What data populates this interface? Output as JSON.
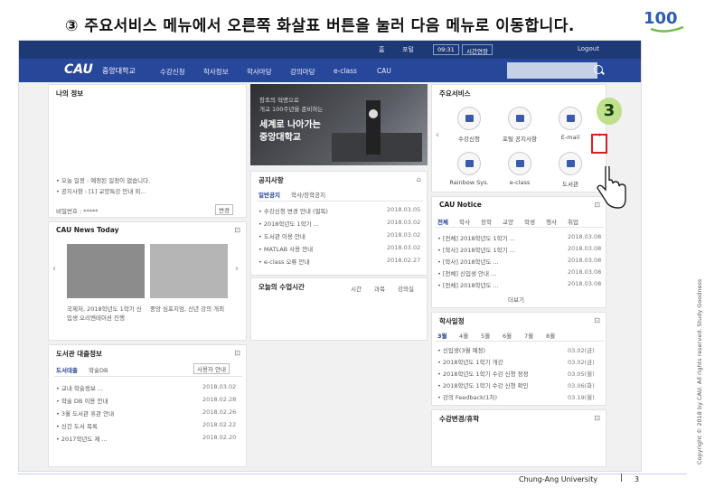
{
  "slide": {
    "title": "③ 주요서비스 메뉴에서 오른쪽 화살표 버튼을 눌러 다음 메뉴로 이동합니다.",
    "copyright": "Copyright © 2018 by CAU. All rights reserved. Study Goodness",
    "footer_university": "Chung-Ang University",
    "footer_separator": "|",
    "page_number": "3",
    "step_badge": "3",
    "logo_text": "100"
  },
  "portal": {
    "topbar": {
      "links": [
        "홈",
        "포털",
        "09:31",
        "로그아웃"
      ],
      "buttons": [
        "시간연장",
        "Logout"
      ]
    },
    "brand": "CAU",
    "brand_sub": "중앙대학교",
    "nav": [
      "수강신청",
      "학사정보",
      "학사마당",
      "강의마당",
      "e-class",
      "CAU"
    ],
    "my_menu": {
      "title": "나의 정보",
      "lines": [
        "• 오늘 일정 : 예정된 일정이 없습니다.",
        "• 공지사항 : [1] 교양특강 안내 외..."
      ],
      "password_label": "비밀번호 : *****",
      "password_btn": "변경"
    },
    "banner": {
      "line1": "창조의 혁명으로",
      "line2": "개교 100주년을 준비하는",
      "line3": "세계로 나아가는",
      "line4": "중앙대학교"
    },
    "notice": {
      "title": "공지사항",
      "tabs": [
        "일반공지",
        "학사/장학공지"
      ],
      "rows": [
        {
          "text": "• 수강신청 변경 안내 (필독)",
          "date": "2018.03.05"
        },
        {
          "text": "• 2018학년도 1학기 ...",
          "date": "2018.03.02"
        },
        {
          "text": "• 도서관 이용 안내",
          "date": "2018.03.02"
        },
        {
          "text": "• MATLAB 사용 안내",
          "date": "2018.03.02"
        },
        {
          "text": "• e-class 오류 안내",
          "date": "2018.02.27"
        }
      ]
    },
    "today_class": {
      "title": "오늘의 수업시간",
      "cols": [
        "시간",
        "과목",
        "강의실"
      ]
    },
    "news": {
      "title": "CAU News Today",
      "captions": [
        "국제처, 2018학년도 1학기 신입생 오리엔테이션 진행",
        "중앙 심포지엄, 신년 강의 개최"
      ]
    },
    "library": {
      "title": "도서관 대출정보",
      "tabs": [
        "도서대출",
        "학술DB"
      ],
      "button": "사용자 안내",
      "rows": [
        {
          "text": "• 교내 학술정보 ...",
          "date": "2018.03.02"
        },
        {
          "text": "• 학술 DB 이용 안내",
          "date": "2018.02.28"
        },
        {
          "text": "• 3월 도서관 휴관 안내",
          "date": "2018.02.26"
        },
        {
          "text": "• 신간 도서 목록",
          "date": "2018.02.22"
        },
        {
          "text": "• 2017학년도 제 ...",
          "date": "2018.02.20"
        }
      ]
    },
    "services": {
      "title": "주요서비스",
      "items": [
        "수강신청",
        "포털 공지사항",
        "E-mail",
        "Rainbow Sys.",
        "e-class",
        "도서관"
      ]
    },
    "cau_notice": {
      "title": "CAU Notice",
      "tabs": [
        "전체",
        "학사",
        "장학",
        "교양",
        "학생",
        "행사",
        "취업"
      ],
      "rows": [
        {
          "text": "• [전체] 2018학년도 1학기 ...",
          "date": "2018.03.08"
        },
        {
          "text": "• [학사] 2018학년도 1학기 ...",
          "date": "2018.03.08"
        },
        {
          "text": "• [학사] 2018학년도 ...",
          "date": "2018.03.08"
        },
        {
          "text": "• [전체] 신입생 안내 ...",
          "date": "2018.03.08"
        },
        {
          "text": "• [전체] 2018학년도 ...",
          "date": "2018.03.08"
        }
      ],
      "more": "더보기"
    },
    "schedule": {
      "title": "학사일정",
      "months": [
        "3월",
        "4월",
        "5월",
        "6월",
        "7월",
        "8월"
      ],
      "rows": [
        {
          "text": "• 신입생(3월 예정)",
          "date": "03.02(금)"
        },
        {
          "text": "• 2018학년도 1학기 개강",
          "date": "03.02(금)"
        },
        {
          "text": "• 2018학년도 1학기 수강 신청 정정",
          "date": "03.05(월)"
        },
        {
          "text": "• 2018학년도 1학기 수강 신청 확인",
          "date": "03.06(화)"
        },
        {
          "text": "• 강의 Feedback(1차)",
          "date": "03.19(월)"
        }
      ]
    },
    "bottom_panel": {
      "title": "수강변경/휴학"
    }
  }
}
